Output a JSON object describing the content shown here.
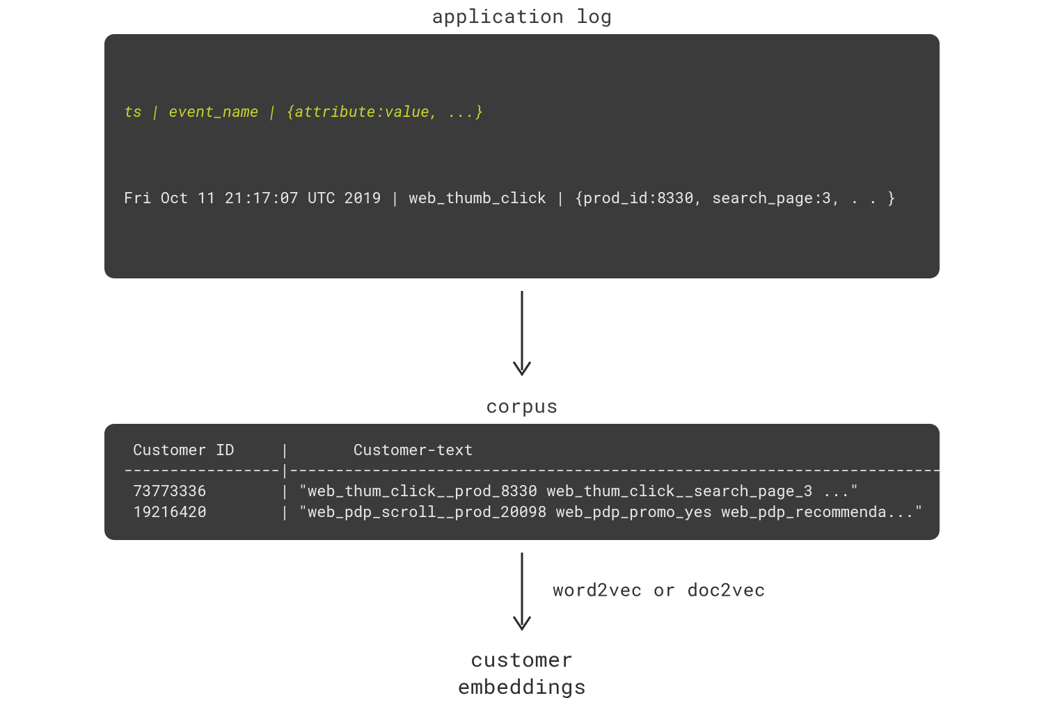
{
  "titles": {
    "app_log": "application log",
    "corpus": "corpus",
    "embeddings_line1": "customer",
    "embeddings_line2": "embeddings"
  },
  "app_log": {
    "schema": "ts | event_name | {attribute:value, ...}",
    "example": "Fri Oct 11 21:17:07 UTC 2019 | web_thumb_click | {prod_id:8330, search_page:3, . . }"
  },
  "corpus": {
    "header_line": " Customer ID     |       Customer-text",
    "divider_line": "-----------------|-------------------------------------------------------------------------",
    "rows": [
      " 73773336        | \"web_thum_click__prod_8330 web_thum_click__search_page_3 ...\"",
      " 19216420        | \"web_pdp_scroll__prod_20098 web_pdp_promo_yes web_pdp_recommenda...\""
    ]
  },
  "arrows": {
    "method_label": "word2vec or doc2vec"
  }
}
